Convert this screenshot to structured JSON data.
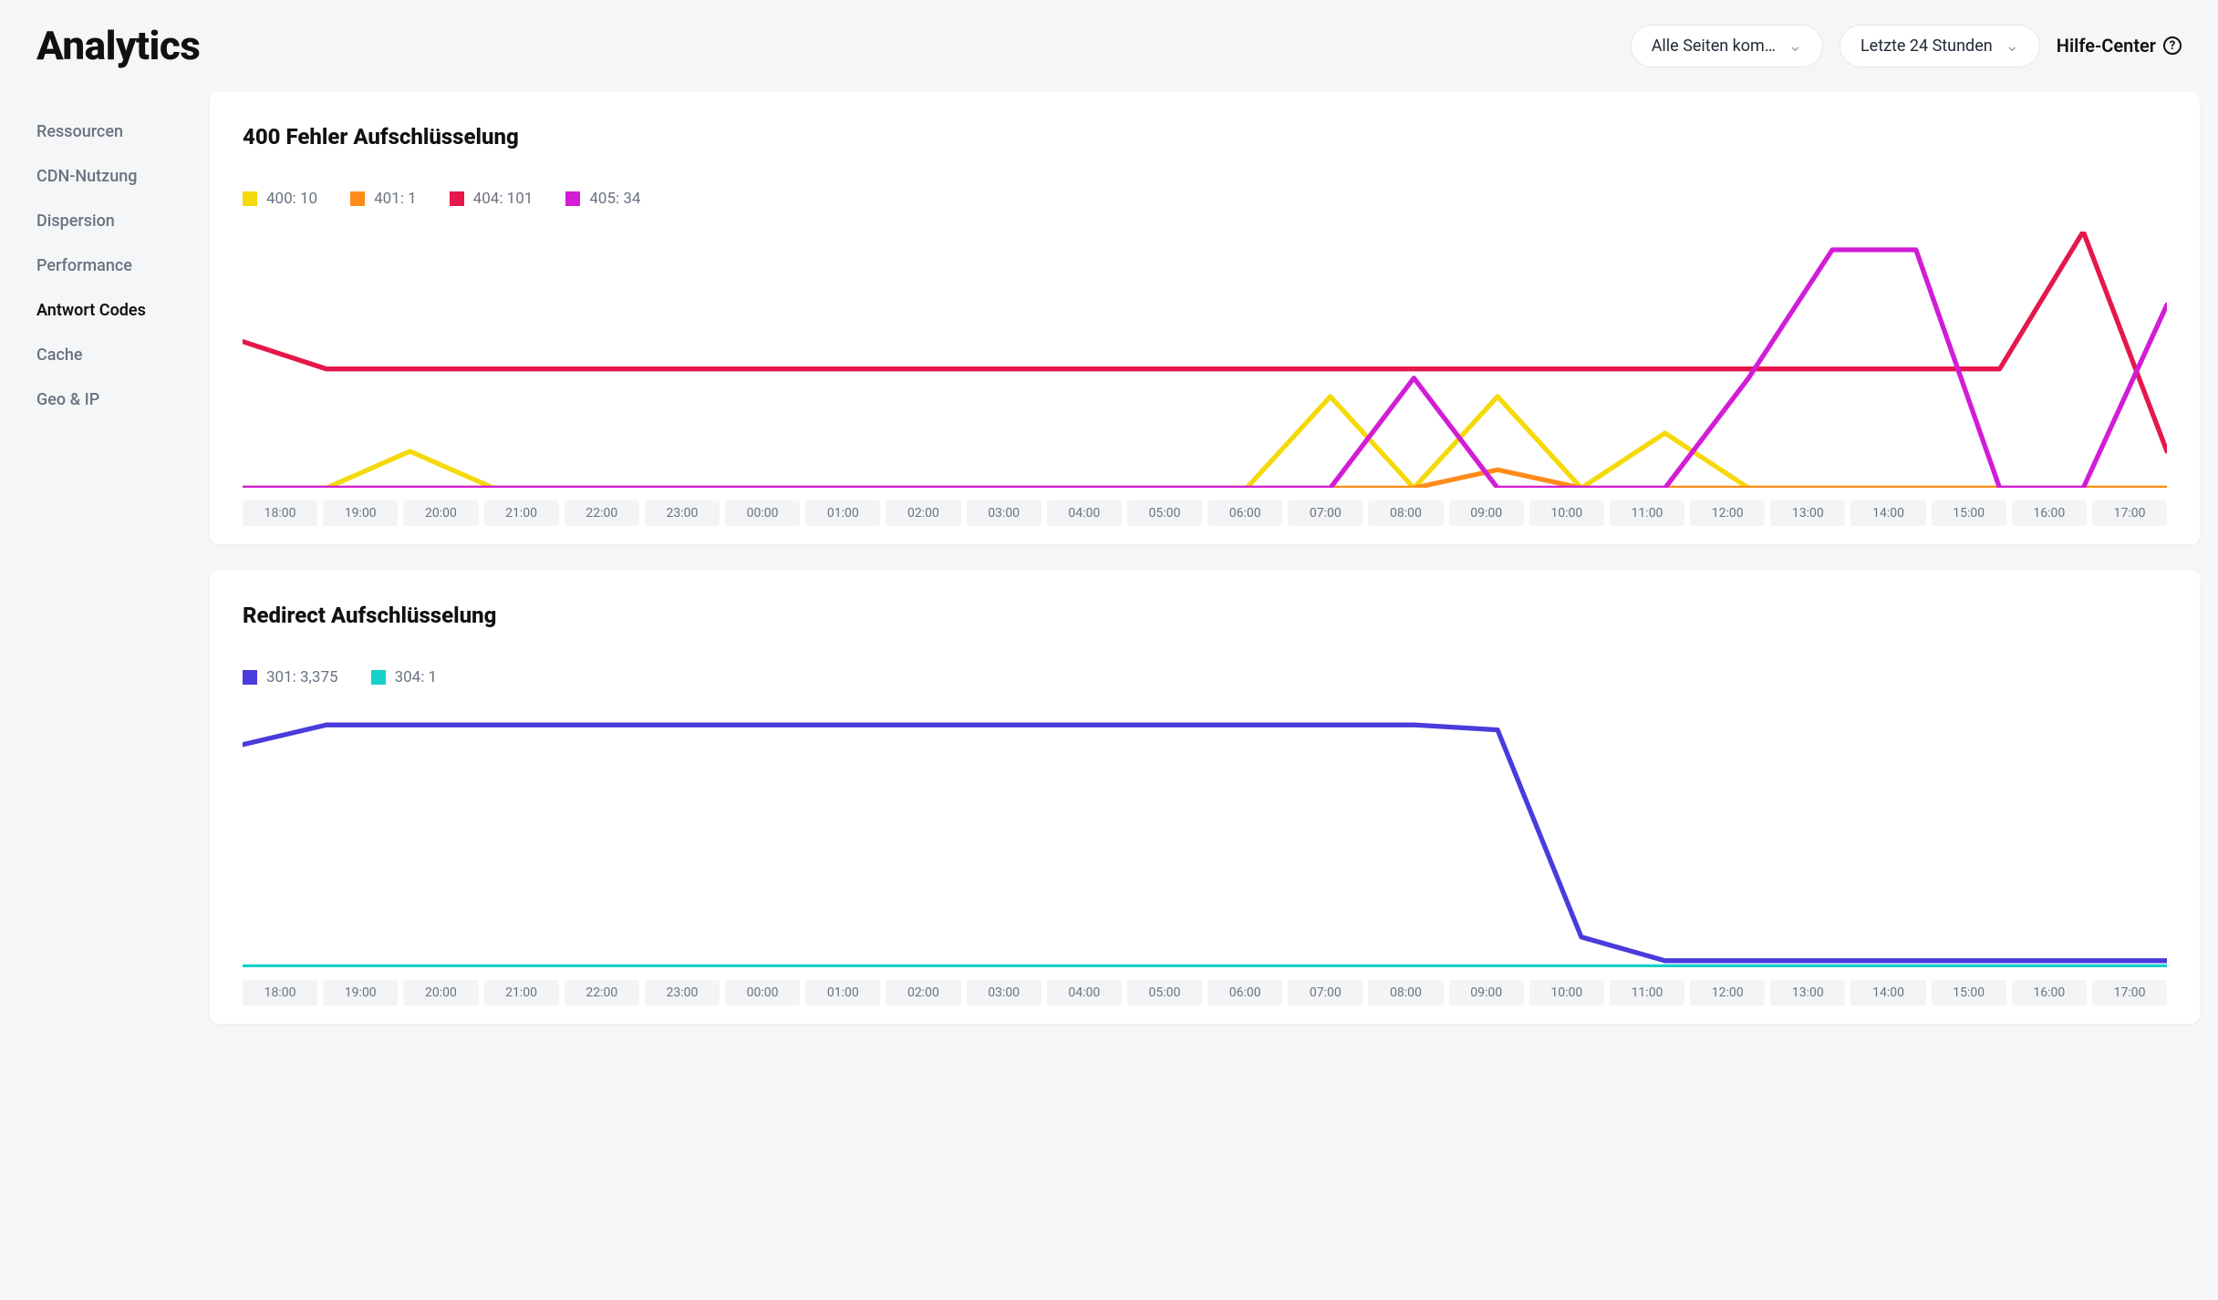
{
  "header": {
    "title": "Analytics",
    "filter_pages": "Alle Seiten kom…",
    "filter_time": "Letzte 24 Stunden",
    "help": "Hilfe-Center"
  },
  "sidebar": {
    "items": [
      {
        "label": "Ressourcen",
        "active": false
      },
      {
        "label": "CDN-Nutzung",
        "active": false
      },
      {
        "label": "Dispersion",
        "active": false
      },
      {
        "label": "Performance",
        "active": false
      },
      {
        "label": "Antwort Codes",
        "active": true
      },
      {
        "label": "Cache",
        "active": false
      },
      {
        "label": "Geo & IP",
        "active": false
      }
    ]
  },
  "charts": [
    {
      "title": "400 Fehler Aufschlüsselung",
      "legend": [
        {
          "label": "400: 10",
          "color": "#f5d90a"
        },
        {
          "label": "401: 1",
          "color": "#ff8c1a"
        },
        {
          "label": "404: 101",
          "color": "#e6174a"
        },
        {
          "label": "405: 34",
          "color": "#d21cd6"
        }
      ]
    },
    {
      "title": "Redirect Aufschlüsselung",
      "legend": [
        {
          "label": "301: 3,375",
          "color": "#4a3bdc"
        },
        {
          "label": "304: 1",
          "color": "#14d1c9"
        }
      ]
    }
  ],
  "x_categories": [
    "18:00",
    "19:00",
    "20:00",
    "21:00",
    "22:00",
    "23:00",
    "00:00",
    "01:00",
    "02:00",
    "03:00",
    "04:00",
    "05:00",
    "06:00",
    "07:00",
    "08:00",
    "09:00",
    "10:00",
    "11:00",
    "12:00",
    "13:00",
    "14:00",
    "15:00",
    "16:00",
    "17:00"
  ],
  "chart_data": [
    {
      "type": "line",
      "title": "400 Fehler Aufschlüsselung",
      "xlabel": "",
      "ylabel": "",
      "categories": [
        "18:00",
        "19:00",
        "20:00",
        "21:00",
        "22:00",
        "23:00",
        "00:00",
        "01:00",
        "02:00",
        "03:00",
        "04:00",
        "05:00",
        "06:00",
        "07:00",
        "08:00",
        "09:00",
        "10:00",
        "11:00",
        "12:00",
        "13:00",
        "14:00",
        "15:00",
        "16:00",
        "17:00"
      ],
      "ylim": [
        0,
        14
      ],
      "series": [
        {
          "name": "400",
          "total": 10,
          "color": "#f5d90a",
          "values": [
            0,
            0,
            2,
            0,
            0,
            0,
            0,
            0,
            0,
            0,
            0,
            0,
            0,
            5,
            0,
            5,
            0,
            3,
            0,
            0,
            0,
            0,
            0,
            0
          ]
        },
        {
          "name": "401",
          "total": 1,
          "color": "#ff8c1a",
          "values": [
            0,
            0,
            0,
            0,
            0,
            0,
            0,
            0,
            0,
            0,
            0,
            0,
            0,
            0,
            0,
            1,
            0,
            0,
            0,
            0,
            0,
            0,
            0,
            0
          ]
        },
        {
          "name": "404",
          "total": 101,
          "color": "#e6174a",
          "values": [
            8,
            6.5,
            6.5,
            6.5,
            6.5,
            6.5,
            6.5,
            6.5,
            6.5,
            6.5,
            6.5,
            6.5,
            6.5,
            6.5,
            6.5,
            6.5,
            6.5,
            6.5,
            6.5,
            6.5,
            6.5,
            6.5,
            14,
            2
          ]
        },
        {
          "name": "405",
          "total": 34,
          "color": "#d21cd6",
          "values": [
            0,
            0,
            0,
            0,
            0,
            0,
            0,
            0,
            0,
            0,
            0,
            0,
            0,
            0,
            6,
            0,
            0,
            0,
            6,
            13,
            13,
            0,
            0,
            10
          ]
        }
      ]
    },
    {
      "type": "line",
      "title": "Redirect Aufschlüsselung",
      "xlabel": "",
      "ylabel": "",
      "categories": [
        "18:00",
        "19:00",
        "20:00",
        "21:00",
        "22:00",
        "23:00",
        "00:00",
        "01:00",
        "02:00",
        "03:00",
        "04:00",
        "05:00",
        "06:00",
        "07:00",
        "08:00",
        "09:00",
        "10:00",
        "11:00",
        "12:00",
        "13:00",
        "14:00",
        "15:00",
        "16:00",
        "17:00"
      ],
      "ylim": [
        0,
        260
      ],
      "series": [
        {
          "name": "301",
          "total": 3375,
          "color": "#4a3bdc",
          "values": [
            225,
            245,
            245,
            245,
            245,
            245,
            245,
            245,
            245,
            245,
            245,
            245,
            245,
            245,
            245,
            240,
            30,
            6,
            6,
            6,
            6,
            6,
            6,
            6
          ]
        },
        {
          "name": "304",
          "total": 1,
          "color": "#14d1c9",
          "values": [
            0,
            0,
            0,
            0,
            0,
            0,
            0,
            0,
            0,
            0,
            0,
            0,
            0,
            0,
            0,
            0,
            0,
            0,
            0,
            0,
            0,
            0,
            0,
            0
          ]
        }
      ]
    }
  ]
}
